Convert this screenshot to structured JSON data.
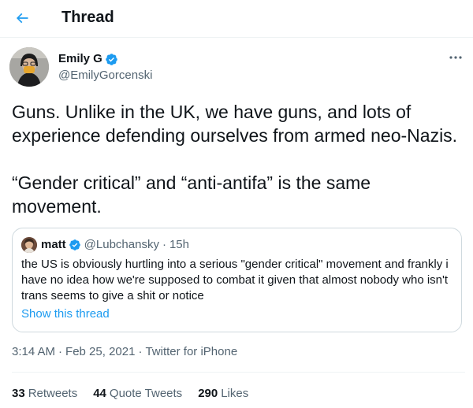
{
  "header": {
    "title": "Thread",
    "back_icon": "arrow-left-icon"
  },
  "author": {
    "name": "Emily G",
    "handle": "@EmilyGorcenski",
    "verified": true
  },
  "tweet": {
    "paragraphs": [
      "Guns. Unlike in the UK, we have guns, and lots of experience defending ourselves from armed neo-Nazis.",
      "“Gender critical” and “anti-antifa” is the same movement."
    ]
  },
  "quote": {
    "name": "matt",
    "handle": "@Lubchansky",
    "separator": "·",
    "time": "15h",
    "text": "the US is obviously hurtling into a serious \"gender critical\" movement and frankly i have no idea how we're supposed to combat it given that almost nobody who isn't trans seems to give a shit or notice",
    "link_label": "Show this thread"
  },
  "meta": {
    "time": "3:14 AM",
    "separator": "·",
    "date": "Feb 25, 2021",
    "source": "Twitter for iPhone"
  },
  "stats": [
    {
      "count": "33",
      "label": "Retweets"
    },
    {
      "count": "44",
      "label": "Quote Tweets"
    },
    {
      "count": "290",
      "label": "Likes"
    }
  ],
  "colors": {
    "accent": "#1d9bf0",
    "text": "#0f1419",
    "secondary": "#536471",
    "border": "#cfd9de"
  }
}
